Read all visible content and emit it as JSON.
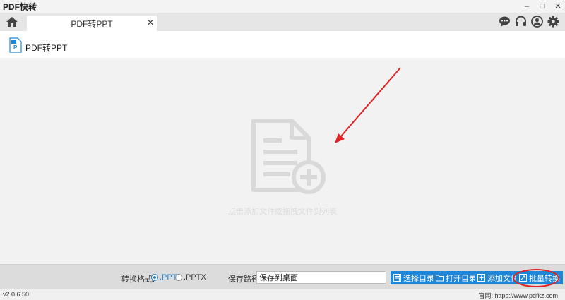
{
  "window": {
    "title": "PDF快转",
    "controls": {
      "minimize": "–",
      "maximize": "□",
      "close": "✕"
    }
  },
  "tabbar": {
    "home_icon": "home-icon",
    "tabs": [
      {
        "label": "PDF转PPT",
        "close": "✕",
        "active": true
      }
    ],
    "right_icons": [
      "chat-icon",
      "headset-icon",
      "user-icon",
      "gear-icon"
    ]
  },
  "subheader": {
    "icon": "ppt-file-icon",
    "title": "PDF转PPT"
  },
  "dropzone": {
    "icon": "add-file-icon",
    "hint": "点击添加文件或拖拽文件到列表"
  },
  "bottom": {
    "format_label": "转换格式:",
    "formats": [
      {
        "label": ".PPT",
        "checked": true
      },
      {
        "label": ".PPTX",
        "checked": false
      }
    ],
    "path_label": "保存路径:",
    "path_value": "保存到桌面",
    "buttons": {
      "select_dir": "选择目录",
      "open_dir": "打开目录",
      "add_file": "添加文件",
      "batch_convert": "批量转换"
    }
  },
  "status": {
    "version": "v2.0.6.50",
    "site": "官网: https://www.pdfkz.com"
  },
  "colors": {
    "accent": "#1e86d8",
    "annotation": "#e02222"
  }
}
